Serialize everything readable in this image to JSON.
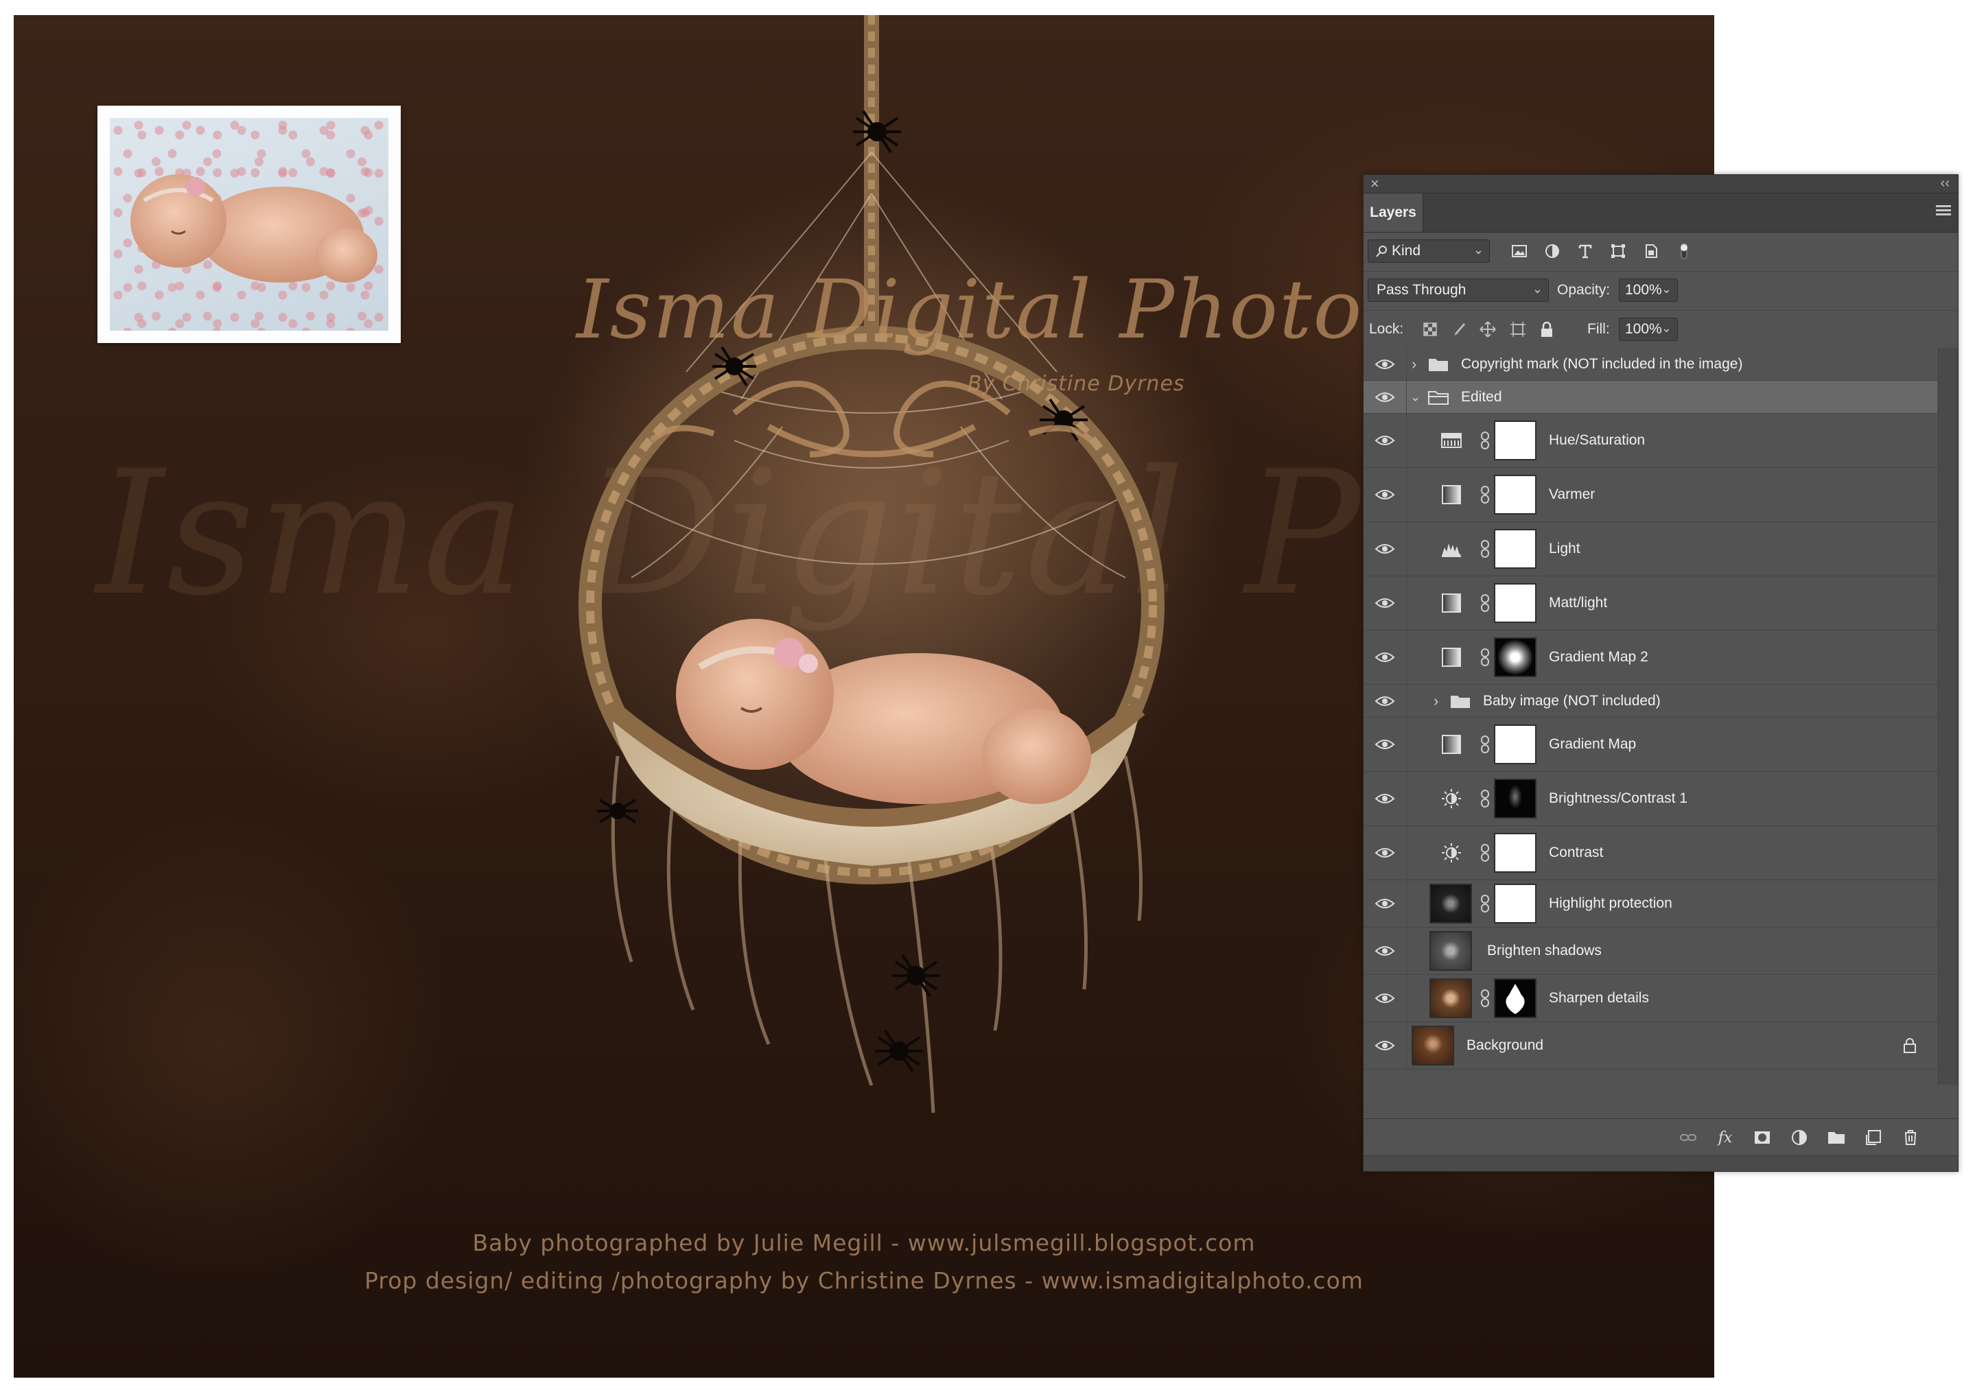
{
  "artwork": {
    "watermark_big": "Isma Digital Ph",
    "watermark_title": "Isma Digital Photo",
    "watermark_subtitle": "By Christine Dyrnes",
    "credit_line1": "Baby photographed by Julie Megill - www.julsmegill.blogspot.com",
    "credit_line2": "Prop design/ editing /photography by Christine Dyrnes - www.ismadigitalphoto.com"
  },
  "layers_panel": {
    "tab_label": "Layers",
    "filter_kind": "Kind",
    "filter_icons": [
      "pixel-layer-filter-icon",
      "adjustment-layer-filter-icon",
      "type-layer-filter-icon",
      "shape-layer-filter-icon",
      "smart-object-filter-icon",
      "filter-toggle-icon"
    ],
    "blend_mode": "Pass Through",
    "opacity_label": "Opacity:",
    "opacity_value": "100%",
    "lock_label": "Lock:",
    "fill_label": "Fill:",
    "fill_value": "100%",
    "layers": [
      {
        "name": "Copyright mark (NOT included in the image)",
        "type": "group",
        "expanded": false,
        "visible": true
      },
      {
        "name": "Edited",
        "type": "group",
        "expanded": true,
        "visible": true,
        "selected": true
      },
      {
        "name": "Hue/Saturation",
        "type": "adjustment",
        "icon": "hue-saturation-icon",
        "mask": "white",
        "visible": true
      },
      {
        "name": "Varmer",
        "type": "adjustment",
        "icon": "gradient-map-icon",
        "mask": "white",
        "visible": true
      },
      {
        "name": "Light",
        "type": "adjustment",
        "icon": "levels-icon",
        "mask": "white",
        "visible": true
      },
      {
        "name": "Matt/light",
        "type": "adjustment",
        "icon": "gradient-map-icon",
        "mask": "white",
        "visible": true
      },
      {
        "name": "Gradient Map 2",
        "type": "adjustment",
        "icon": "gradient-map-icon",
        "mask": "radial",
        "visible": true
      },
      {
        "name": "Baby image (NOT included)",
        "type": "group",
        "expanded": false,
        "visible": true
      },
      {
        "name": "Gradient Map",
        "type": "adjustment",
        "icon": "gradient-map-icon",
        "mask": "white",
        "visible": true
      },
      {
        "name": "Brightness/Contrast 1",
        "type": "adjustment",
        "icon": "brightness-contrast-icon",
        "mask": "dark",
        "visible": true
      },
      {
        "name": "Contrast",
        "type": "adjustment",
        "icon": "brightness-contrast-icon",
        "mask": "white",
        "visible": true
      },
      {
        "name": "Highlight protection",
        "type": "pixel",
        "mask": "white",
        "visible": true
      },
      {
        "name": "Brighten shadows",
        "type": "pixel",
        "visible": true
      },
      {
        "name": "Sharpen details",
        "type": "pixel",
        "mask": "silhouette",
        "visible": true
      },
      {
        "name": "Background",
        "type": "background",
        "locked": true,
        "visible": true
      }
    ],
    "footer_icons": [
      "link-layers-icon",
      "fx-icon",
      "add-mask-icon",
      "new-adjustment-icon",
      "new-group-icon",
      "new-layer-icon",
      "delete-layer-icon"
    ]
  }
}
